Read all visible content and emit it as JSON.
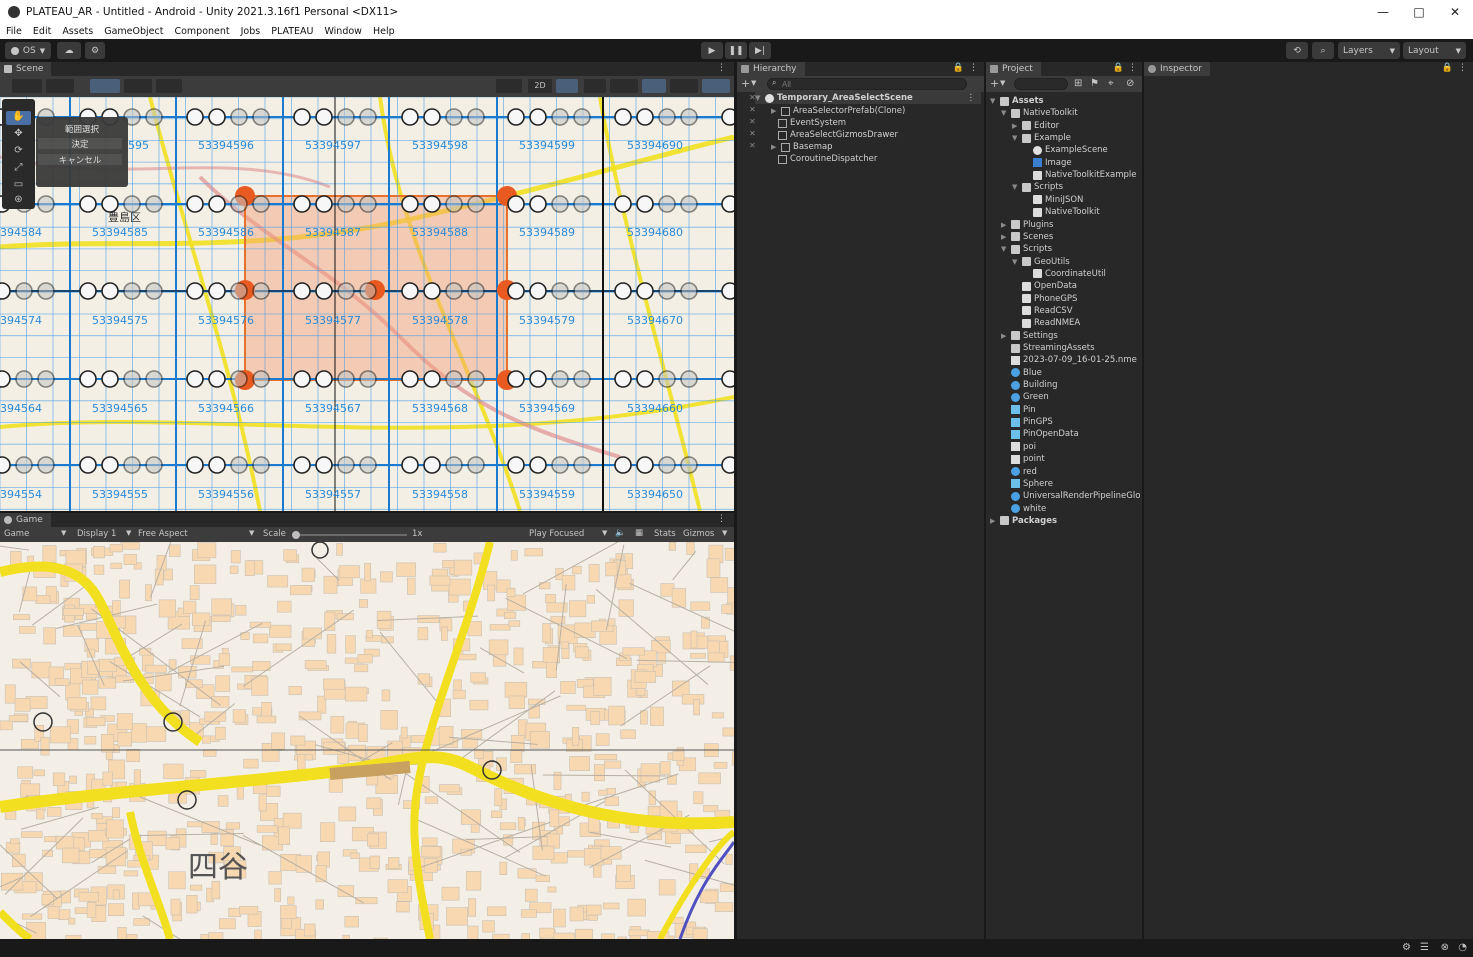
{
  "window": {
    "title": "PLATEAU_AR - Untitled - Android - Unity 2021.3.16f1 Personal <DX11>",
    "controls": [
      "—",
      "□",
      "✕"
    ]
  },
  "menu": [
    "File",
    "Edit",
    "Assets",
    "GameObject",
    "Component",
    "Jobs",
    "PLATEAU",
    "Window",
    "Help"
  ],
  "toolbar": {
    "account": "OS",
    "layers": "Layers",
    "layout": "Layout"
  },
  "scene": {
    "tab": "Scene",
    "mode_2d": "2D",
    "tool_menu": {
      "title": "範囲選択",
      "confirm": "決定",
      "cancel": "キャンセル"
    },
    "map_labels": {
      "ward": "豊島区",
      "grid_codes": [
        "595",
        "53394596",
        "53394597",
        "53394598",
        "53394599",
        "53394690",
        "394584",
        "53394585",
        "53394586",
        "53394587",
        "53394588",
        "53394589",
        "53394680",
        "394574",
        "53394575",
        "53394576",
        "53394577",
        "53394578",
        "53394579",
        "53394670",
        "394564",
        "53394565",
        "53394566",
        "53394567",
        "53394568",
        "53394569",
        "53394660",
        "394554",
        "53394555",
        "53394556",
        "53394557",
        "53394558",
        "53394559",
        "53394650"
      ]
    }
  },
  "game": {
    "tab": "Game",
    "mode": "Game",
    "display": "Display 1",
    "aspect": "Free Aspect",
    "scale_label": "Scale",
    "scale_value": "1x",
    "play_mode": "Play Focused",
    "stats": "Stats",
    "gizmos": "Gizmos",
    "map_label": "四谷"
  },
  "hierarchy": {
    "tab": "Hierarchy",
    "search_placeholder": "All",
    "scene_name": "Temporary_AreaSelectScene",
    "items": [
      "AreaSelectorPrefab(Clone)",
      "EventSystem",
      "AreaSelectGizmosDrawer",
      "Basemap",
      "CoroutineDispatcher"
    ]
  },
  "project": {
    "tab": "Project",
    "items": [
      {
        "label": "Assets",
        "type": "folder"
      },
      {
        "label": "NativeToolkit",
        "type": "folder"
      },
      {
        "label": "Editor",
        "type": "folder"
      },
      {
        "label": "Example",
        "type": "folder"
      },
      {
        "label": "ExampleScene",
        "type": "scene"
      },
      {
        "label": "Image",
        "type": "image"
      },
      {
        "label": "NativeToolkitExample",
        "type": "script"
      },
      {
        "label": "Scripts",
        "type": "folder"
      },
      {
        "label": "MiniJSON",
        "type": "script"
      },
      {
        "label": "NativeToolkit",
        "type": "script"
      },
      {
        "label": "Plugins",
        "type": "folder"
      },
      {
        "label": "Scenes",
        "type": "folder"
      },
      {
        "label": "Scripts",
        "type": "folder"
      },
      {
        "label": "GeoUtils",
        "type": "folder"
      },
      {
        "label": "CoordinateUtil",
        "type": "script"
      },
      {
        "label": "OpenData",
        "type": "script"
      },
      {
        "label": "PhoneGPS",
        "type": "script"
      },
      {
        "label": "ReadCSV",
        "type": "script"
      },
      {
        "label": "ReadNMEA",
        "type": "script"
      },
      {
        "label": "Settings",
        "type": "folder"
      },
      {
        "label": "StreamingAssets",
        "type": "folder"
      },
      {
        "label": "2023-07-09_16-01-25.nme",
        "type": "text"
      },
      {
        "label": "Blue",
        "type": "material"
      },
      {
        "label": "Building",
        "type": "material"
      },
      {
        "label": "Green",
        "type": "material"
      },
      {
        "label": "Pin",
        "type": "prefab"
      },
      {
        "label": "PinGPS",
        "type": "prefab"
      },
      {
        "label": "PinOpenData",
        "type": "prefab"
      },
      {
        "label": "poi",
        "type": "text"
      },
      {
        "label": "point",
        "type": "text"
      },
      {
        "label": "red",
        "type": "material"
      },
      {
        "label": "Sphere",
        "type": "prefab"
      },
      {
        "label": "UniversalRenderPipelineGlo",
        "type": "asset"
      },
      {
        "label": "white",
        "type": "material"
      },
      {
        "label": "Packages",
        "type": "folder"
      }
    ]
  },
  "inspector": {
    "tab": "Inspector"
  },
  "colors": {
    "editor_bg": "#191919",
    "panel_bg": "#282828",
    "grid_blue": "#2a8ad8",
    "selection_orange": "#e85a20",
    "road_yellow": "#f2e020"
  }
}
